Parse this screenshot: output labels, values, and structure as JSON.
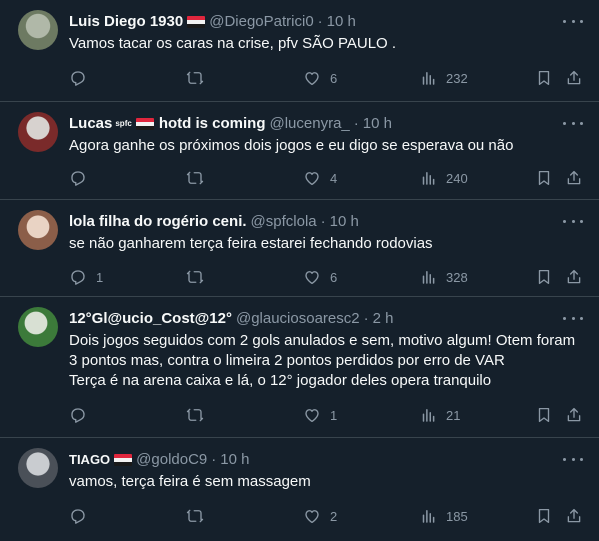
{
  "tweets": [
    {
      "name": "Luis Diego 1930",
      "has_flag": true,
      "name_extra": "",
      "handle": "@DiegoPatrici0",
      "time": "10 h",
      "text": [
        "Vamos tacar os caras na crise, pfv SÃO PAULO ."
      ],
      "replies": "",
      "retweets": "",
      "likes": "6",
      "views": "232",
      "avatar_colors": [
        "#b0b8a8",
        "#6d7a62"
      ]
    },
    {
      "name": "Lucas",
      "spfc_mark": "spfc",
      "has_flag": true,
      "name_extra": "hotd is coming",
      "handle": "@lucenyra_",
      "time": "10 h",
      "text": [
        "Agora ganhe os próximos dois jogos e eu digo se esperava ou não"
      ],
      "replies": "",
      "retweets": "",
      "likes": "4",
      "views": "240",
      "avatar_colors": [
        "#d7d2cf",
        "#7a2a2a"
      ]
    },
    {
      "name": "lola filha do rogério ceni.",
      "has_flag": false,
      "name_extra": "",
      "handle": "@spfclola",
      "time": "10 h",
      "text": [
        "se não ganharem terça feira estarei fechando rodovias"
      ],
      "replies": "1",
      "retweets": "",
      "likes": "6",
      "views": "328",
      "avatar_colors": [
        "#e9d3c4",
        "#8b5e49"
      ]
    },
    {
      "name": "12°Gl@ucio_Cost@12°",
      "has_flag": false,
      "name_extra": "",
      "handle": "@glauciosoaresc2",
      "time": "2 h",
      "text": [
        "Dois jogos seguidos com 2 gols anulados e sem, motivo algum! Otem foram",
        "3 pontos mas, contra o limeira 2 pontos perdidos por erro de VAR",
        "Terça é na arena caixa e lá, o 12° jogador deles opera tranquilo"
      ],
      "replies": "",
      "retweets": "",
      "likes": "1",
      "views": "21",
      "avatar_colors": [
        "#d8e0d3",
        "#3c7a3a"
      ]
    },
    {
      "name": "TIAGO",
      "has_flag": true,
      "name_extra": "",
      "handle": "@goldoC9",
      "time": "10 h",
      "text": [
        "vamos, terça feira é sem massagem"
      ],
      "replies": "",
      "retweets": "",
      "likes": "2",
      "views": "185",
      "avatar_colors": [
        "#c9ccd0",
        "#4a5058"
      ]
    }
  ]
}
